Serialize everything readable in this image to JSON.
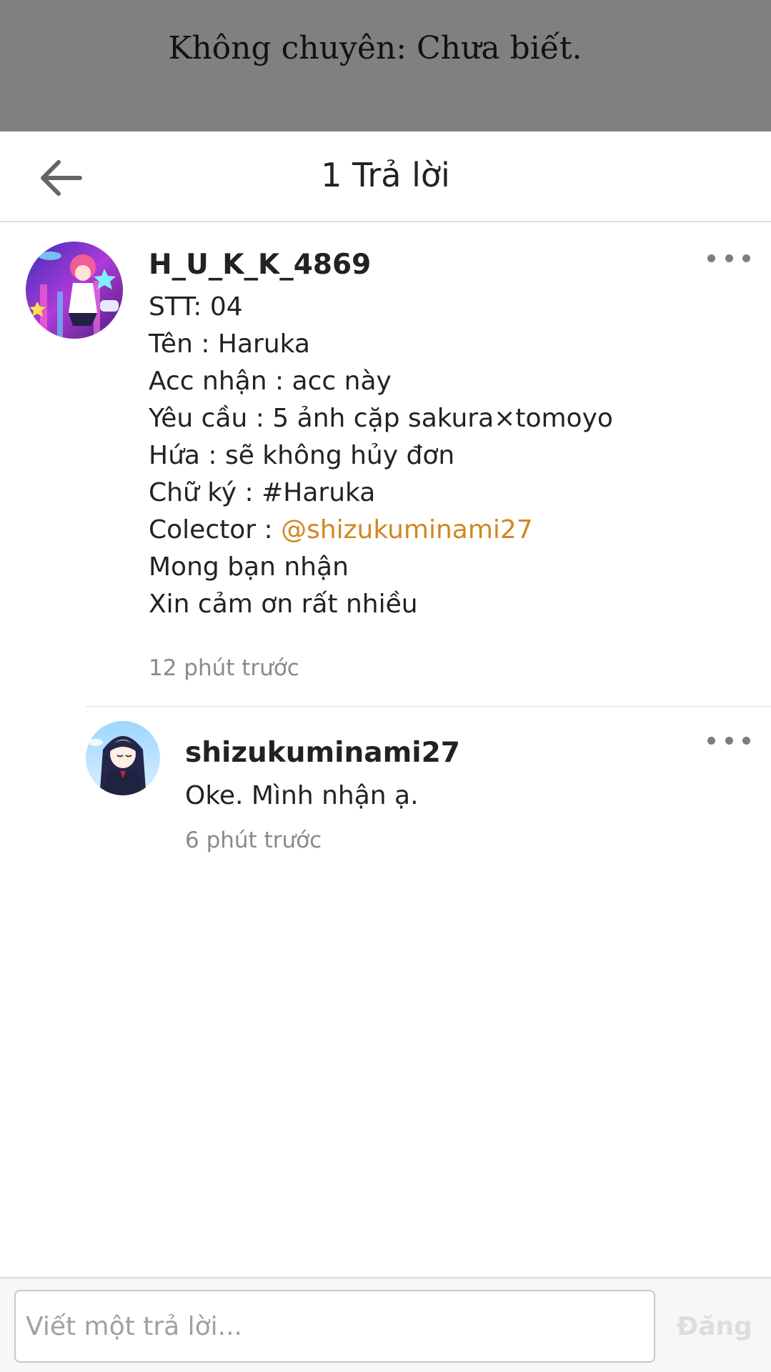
{
  "backdrop": {
    "text": "Không chuyên: Chưa biết."
  },
  "header": {
    "title": "1 Trả lời",
    "back_icon": "arrow-left-icon"
  },
  "comment": {
    "username": "H_U_K_K_4869",
    "lines": [
      "STT: 04",
      "Tên : Haruka",
      "Acc nhận : acc này",
      "Yêu cầu : 5 ảnh cặp sakura×tomoyo",
      "Hứa : sẽ không hủy đơn",
      "Chữ ký : #Haruka"
    ],
    "collector_label": "Colector : ",
    "collector_mention": "@shizukuminami27",
    "closing_lines": [
      "Mong bạn nhận",
      "Xin cảm ơn rất nhiều"
    ],
    "timestamp": "12 phút trước",
    "more_icon": "more-horizontal-icon"
  },
  "reply": {
    "username": "shizukuminami27",
    "text": "Oke. Mình nhận ạ.",
    "timestamp": "6 phút trước",
    "more_icon": "more-horizontal-icon"
  },
  "footer": {
    "input_placeholder": "Viết một trả lời...",
    "post_label": "Đăng"
  },
  "colors": {
    "mention": "#d2871e",
    "backdrop": "#808080"
  }
}
